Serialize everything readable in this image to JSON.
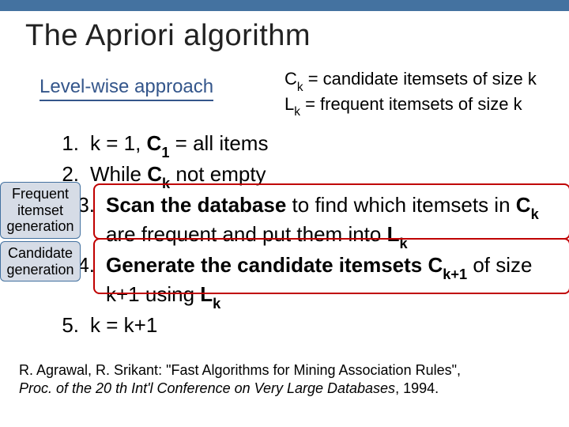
{
  "title": "The Apriori algorithm",
  "level_label": "Level-wise approach",
  "notation": {
    "ck_lhs": "C",
    "ck_sub": "k",
    "ck_rhs": " = candidate itemsets of size k",
    "lk_lhs": "L",
    "lk_sub": "k",
    "lk_rhs": " = frequent itemsets of size k"
  },
  "steps": {
    "s1_num": "1.",
    "s1_a": "k = 1",
    "s1_b": ", ",
    "s1_c_bold": "C",
    "s1_c_sub": "1",
    "s1_d": " = all items",
    "s2_num": "2.",
    "s2_a": "While ",
    "s2_b_bold": "C",
    "s2_b_sub": "k",
    "s2_c": " not empty",
    "s3_num": "3.",
    "s3_a_bold": "Scan the database",
    "s3_b": " to find which itemsets in ",
    "s3_c_bold": "C",
    "s3_c_sub": "k",
    "s3_d": " are frequent",
    "s3_e": " and put them into ",
    "s3_f_bold": "L",
    "s3_f_sub": "k",
    "s4_num": "4.",
    "s4_a_bold_pre": "Generate the ",
    "s4_a_bold_mid": "candidate itemsets C",
    "s4_a_bold_sub": "k+1",
    "s4_b": " of size k+1 using ",
    "s4_c_bold": "L",
    "s4_c_sub": "k",
    "s5_num": "5.",
    "s5_a": "k = k+1"
  },
  "side_labels": {
    "freq": "Frequent itemset generation",
    "cand": "Candidate generation"
  },
  "cite": {
    "line1_a": "R. Agrawal, R. Srikant: \"Fast Algorithms for Mining Association Rules\", ",
    "line2_ital": "Proc. of the 20 th Int'l Conference on Very Large Databases",
    "line2_b": ", 1994."
  }
}
